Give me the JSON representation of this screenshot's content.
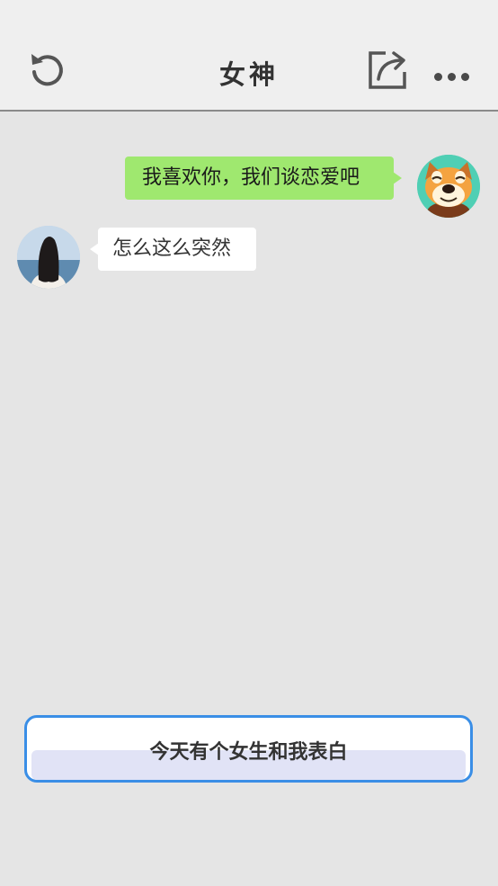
{
  "header": {
    "title": "女神",
    "back_icon": "refresh-back-icon",
    "share_icon": "share-icon",
    "more_icon": "more-dots-icon"
  },
  "messages": [
    {
      "sender": "me",
      "text": "我喜欢你，我们谈恋爱吧",
      "avatar": "dog-avatar"
    },
    {
      "sender": "her",
      "text": "怎么这么突然",
      "avatar": "girl-avatar"
    }
  ],
  "reply_option": {
    "label": "今天有个女生和我表白"
  },
  "colors": {
    "background": "#e5e5e5",
    "header_background": "#efefef",
    "my_bubble": "#9fe86f",
    "her_bubble": "#ffffff",
    "option_border": "#3a8ee6"
  }
}
